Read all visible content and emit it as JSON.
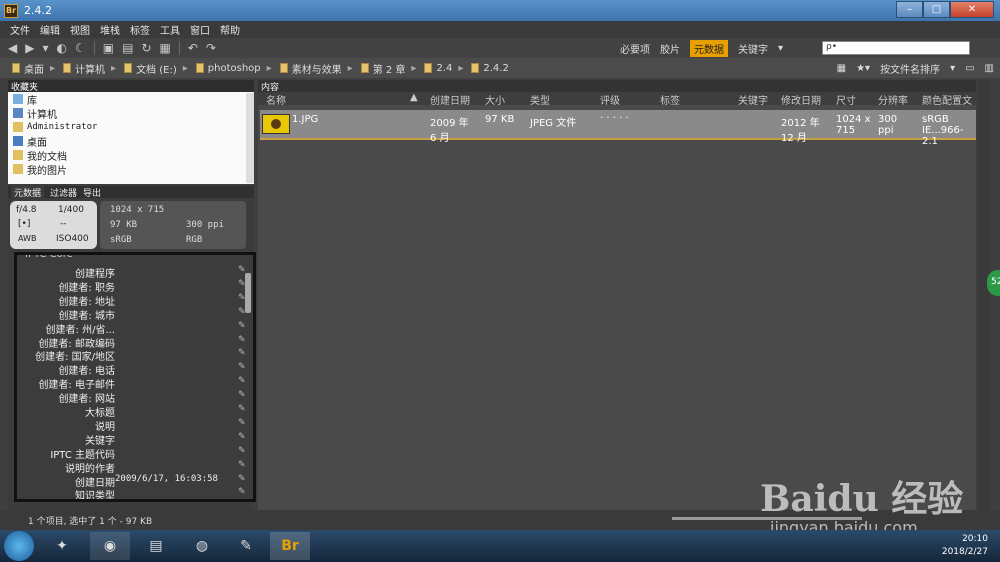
{
  "window": {
    "title": "2.4.2",
    "icon": "Br"
  },
  "menu": [
    "文件",
    "编辑",
    "视图",
    "堆栈",
    "标签",
    "工具",
    "窗口",
    "帮助"
  ],
  "workspaces": {
    "items": [
      "必要项",
      "胶片",
      "元数据",
      "关键字"
    ],
    "active": "元数据"
  },
  "search": {
    "placeholder": "ρ•"
  },
  "breadcrumb": [
    "桌面",
    "计算机",
    "文档 (E:)",
    "photoshop",
    "素材与效果",
    "第 2 章",
    "2.4",
    "2.4.2"
  ],
  "sort_label": "按文件名排序",
  "favorites": {
    "tab": "收藏夹",
    "items": [
      "库",
      "计算机",
      "Administrator",
      "桌面",
      "我的文档",
      "我的图片"
    ]
  },
  "meta_tabs": [
    "元数据",
    "过滤器",
    "导出"
  ],
  "camera": {
    "aperture": "f/4.8",
    "shutter": "1/400",
    "metering": "--",
    "wb": "AWB",
    "iso": "ISO400"
  },
  "fileinfo": {
    "dims": "1024 x 715",
    "size": "97 KB",
    "ppi": "300 ppi",
    "profile": "sRGB",
    "mode": "RGB"
  },
  "iptc": {
    "section": "IPTC Core",
    "rows": [
      {
        "label": "创建程序",
        "value": ""
      },
      {
        "label": "创建者: 职务",
        "value": ""
      },
      {
        "label": "创建者: 地址",
        "value": ""
      },
      {
        "label": "创建者: 城市",
        "value": ""
      },
      {
        "label": "创建者: 州/省...",
        "value": ""
      },
      {
        "label": "创建者: 邮政编码",
        "value": ""
      },
      {
        "label": "创建者: 国家/地区",
        "value": ""
      },
      {
        "label": "创建者: 电话",
        "value": ""
      },
      {
        "label": "创建者: 电子邮件",
        "value": ""
      },
      {
        "label": "创建者: 网站",
        "value": ""
      },
      {
        "label": "大标题",
        "value": ""
      },
      {
        "label": "说明",
        "value": ""
      },
      {
        "label": "关键字",
        "value": ""
      },
      {
        "label": "IPTC 主题代码",
        "value": ""
      },
      {
        "label": "说明的作者",
        "value": ""
      },
      {
        "label": "创建日期",
        "value": "2009/6/17, 16:03:58"
      },
      {
        "label": "知识类型",
        "value": ""
      }
    ]
  },
  "content": {
    "tab": "内容",
    "columns": [
      "名称",
      "创建日期",
      "大小",
      "类型",
      "评级",
      "标签",
      "关键字",
      "修改日期",
      "尺寸",
      "分辨率",
      "颜色配置文件"
    ],
    "file": {
      "name": "1.JPG",
      "created": "2009 年 6 月",
      "size": "97 KB",
      "type": "JPEG 文件",
      "rating": "· · · · ·",
      "modified": "2012 年 12 月",
      "dims": "1024 x 715",
      "res": "300 ppi",
      "profile": "sRGB IE...966-2.1"
    }
  },
  "status": "1 个项目, 选中了 1 个 - 97 KB",
  "clock": {
    "time": "20:10",
    "date": "2018/2/27"
  },
  "badge": "52",
  "watermark": {
    "big": "Baidu 经验",
    "small": "jingyan.baidu.com"
  }
}
